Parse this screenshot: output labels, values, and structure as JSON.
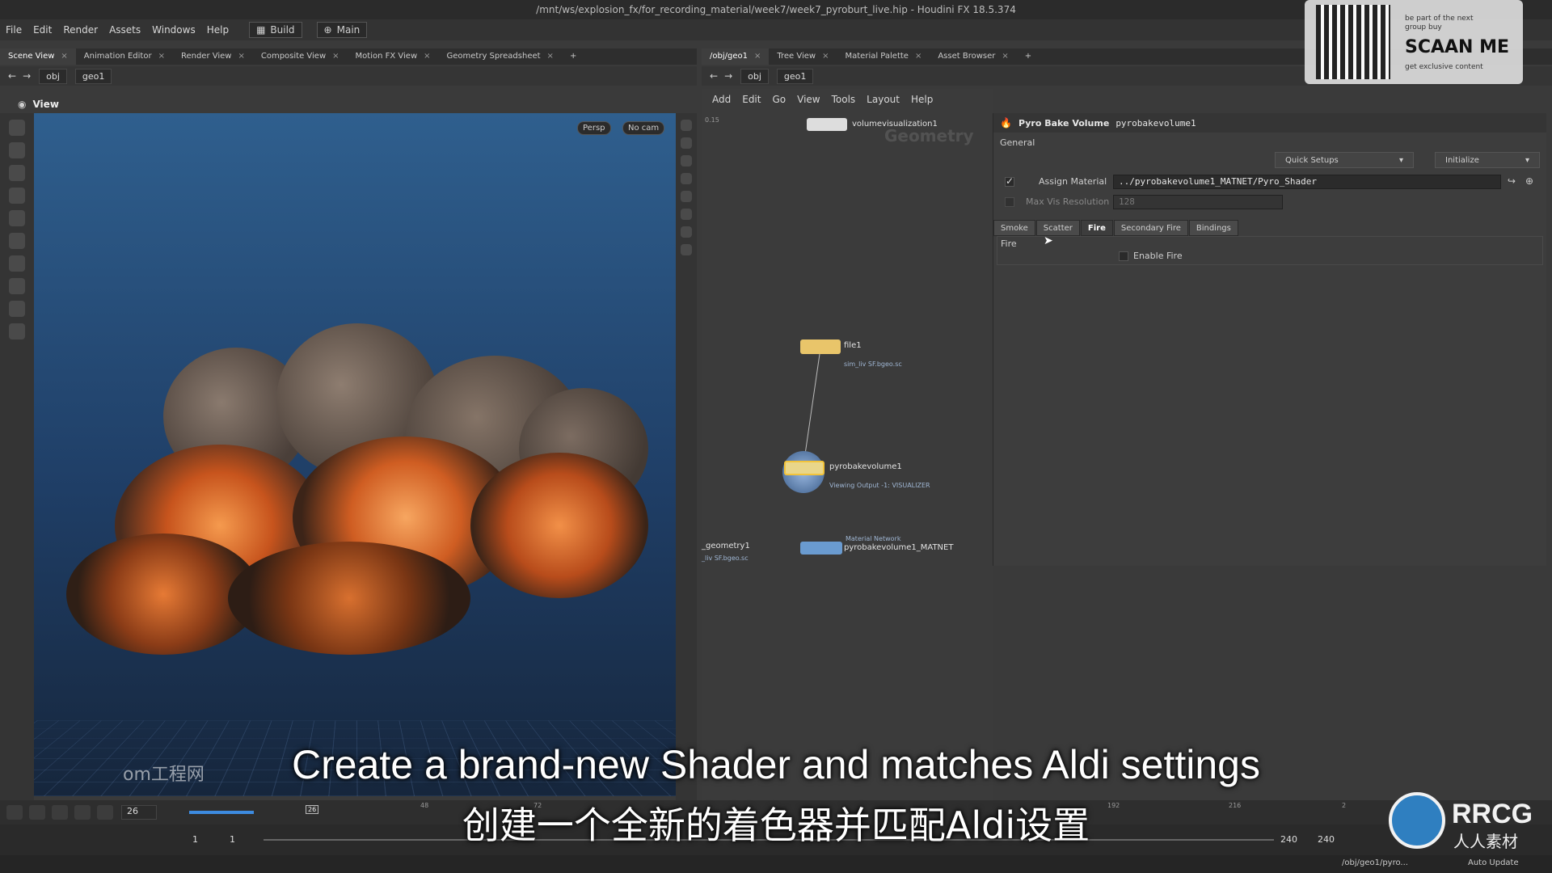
{
  "window": {
    "title": "/mnt/ws/explosion_fx/for_recording_material/week7/week7_pyroburt_live.hip - Houdini FX 18.5.374"
  },
  "menubar": {
    "items": [
      "File",
      "Edit",
      "Render",
      "Assets",
      "Windows",
      "Help"
    ],
    "desktop": "Build",
    "context": "Main"
  },
  "left_tabs": [
    "Scene View",
    "Animation Editor",
    "Render View",
    "Composite View",
    "Motion FX View",
    "Geometry Spreadsheet"
  ],
  "right_tabs": [
    "/obj/geo1",
    "Tree View",
    "Material Palette",
    "Asset Browser"
  ],
  "left_path": {
    "root": "obj",
    "node": "geo1"
  },
  "right_path": {
    "root": "obj",
    "node": "geo1"
  },
  "viewport": {
    "label": "View",
    "persp": "Persp",
    "cam": "No cam"
  },
  "network_menu": [
    "Add",
    "Edit",
    "Go",
    "View",
    "Tools",
    "Layout",
    "Help"
  ],
  "network": {
    "context_label": "Geometry",
    "scale_value": "0.15",
    "nodes": [
      {
        "name": "volumevisualization1"
      },
      {
        "name": "file1",
        "sub": "sim_liv SF.bgeo.sc"
      },
      {
        "name": "pyrobakevolume1",
        "sub": "Viewing Output -1: VISUALIZER"
      },
      {
        "name": "pyrobakevolume1_MATNET",
        "sub": "Material Network"
      },
      {
        "name": "_geometry1",
        "sub": "_liv SF.bgeo.sc"
      }
    ]
  },
  "params": {
    "type": "Pyro Bake Volume",
    "name": "pyrobakevolume1",
    "section": "General",
    "quick_setups": "Quick Setups",
    "initialize": "Initialize",
    "assign_material_label": "Assign Material",
    "assign_material_value": "../pyrobakevolume1_MATNET/Pyro_Shader",
    "assign_material_checked": true,
    "max_vis_label": "Max Vis Resolution",
    "max_vis_value": "128",
    "tabs": [
      "Smoke",
      "Scatter",
      "Fire",
      "Secondary Fire",
      "Bindings"
    ],
    "active_tab": "Fire",
    "folder_label": "Fire",
    "enable_fire_label": "Enable Fire",
    "enable_fire_checked": false
  },
  "timeline": {
    "current_frame": "26",
    "tick_labels": [
      "26",
      "48",
      "72",
      "192",
      "216",
      "2"
    ],
    "start": "1",
    "end": "1",
    "range_start": "240",
    "range_end": "240"
  },
  "status": {
    "path": "/obj/geo1/pyro...",
    "mode": "Auto Update"
  },
  "subtitles": {
    "english": "Create a brand-new Shader and matches Aldi settings",
    "chinese": "创建一个全新的着色器并匹配Aldi设置"
  },
  "overlay": {
    "qr_text1": "be part of the next",
    "qr_text2": "group buy",
    "qr_big": "SCAAN ME",
    "qr_text3": "get exclusive content",
    "logo_text": "RRCG",
    "logo_cn": "人人素材",
    "watermark_left": "om工程网"
  },
  "colors": {
    "fire": "#e8762f",
    "smoke": "#5a4d45",
    "sky_top": "#2f5f8e",
    "sky_bottom": "#16263c"
  }
}
